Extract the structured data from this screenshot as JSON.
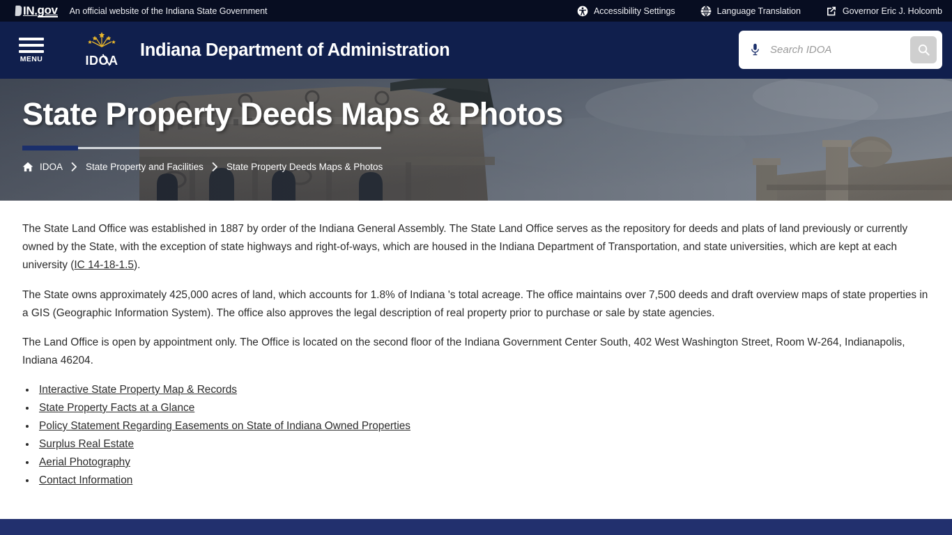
{
  "topbar": {
    "logo": {
      "in": "IN",
      "dot": ".",
      "gov": "gov",
      "icon": "in-gov-logo"
    },
    "tagline": "An official website of the Indiana State Government",
    "links": [
      {
        "label": "Accessibility Settings",
        "icon": "accessibility-icon"
      },
      {
        "label": "Language Translation",
        "icon": "globe-icon"
      },
      {
        "label": "Governor Eric J. Holcomb",
        "icon": "external-link-icon"
      }
    ]
  },
  "header": {
    "menu_label": "MENU",
    "menu_icon": "hamburger-icon",
    "logo_alt": "IDOA",
    "logo_text": "IDOA",
    "agency_title": "Indiana Department of Administration",
    "search": {
      "placeholder": "Search IDOA",
      "value": "",
      "mic_icon": "microphone-icon",
      "submit_icon": "search-icon"
    }
  },
  "hero": {
    "title": "State Property Deeds Maps & Photos",
    "accent_color": "#1b2f6b",
    "breadcrumb": {
      "home_icon": "home-icon",
      "items": [
        {
          "label": "IDOA",
          "current": false
        },
        {
          "label": "State Property and Facilities",
          "current": false
        },
        {
          "label": "State Property Deeds Maps & Photos",
          "current": true
        }
      ]
    }
  },
  "main": {
    "paragraphs": [
      {
        "before": "The State Land Office was established in 1887 by order of the Indiana General Assembly. The State Land Office serves as the repository for deeds and plats of land previously or currently owned by the State, with the exception of state highways and right-of-ways, which are housed in the Indiana Department of Transportation, and state universities, which are kept at each university (",
        "link": "IC 14-18-1.5",
        "after": ")."
      },
      {
        "text": "The State owns approximately 425,000 acres of land, which accounts for 1.8% of Indiana 's total acreage. The office maintains over 7,500 deeds and draft overview maps of state properties in a GIS (Geographic Information System). The office also approves the legal description of real property prior to purchase or sale by state agencies."
      },
      {
        "text": "The Land Office is open by appointment only. The Office is located on the second floor of the Indiana Government Center South, 402 West Washington Street, Room W-264, Indianapolis, Indiana 46204."
      }
    ],
    "links": [
      "Interactive State Property Map & Records",
      "State Property Facts at a Glance",
      "Policy Statement Regarding Easements on State of Indiana Owned Properties",
      "Surplus Real Estate",
      "Aerial Photography",
      "Contact Information"
    ]
  },
  "colors": {
    "topbar_bg": "#070d21",
    "header_bg": "#101f4d",
    "footer_bg": "#22306e",
    "accent": "#1b2f6b"
  }
}
